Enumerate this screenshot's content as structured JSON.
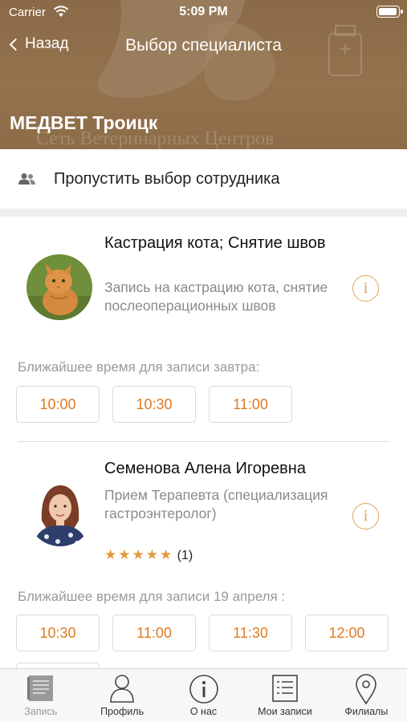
{
  "status_bar": {
    "carrier": "Carrier",
    "time": "5:09 PM"
  },
  "nav": {
    "back_label": "Назад",
    "title": "Выбор специалиста"
  },
  "header": {
    "clinic_name": "МЕДВЕТ Троицк",
    "background_text": "Сеть Ветеринарных Центров"
  },
  "skip": {
    "label": "Пропустить выбор сотрудника",
    "icon": "people-icon"
  },
  "specialists": [
    {
      "name": "Кастрация кота; Снятие швов",
      "description": "Запись на кастрацию кота, снятие послеоперационных швов",
      "nearest_label": "Ближайшее время для записи завтра:",
      "slots": [
        "10:00",
        "10:30",
        "11:00"
      ]
    },
    {
      "name": "Семенова Алена Игоревна",
      "description": "Прием Терапевта (специализация гастроэнтеролог)",
      "rating_stars": "★★★★★",
      "rating_count": "(1)",
      "nearest_label": "Ближайшее время для записи 19 апреля :",
      "slots": [
        "10:30",
        "11:00",
        "11:30",
        "12:00"
      ]
    }
  ],
  "tabs": [
    {
      "label": "Запись",
      "icon": "book-icon",
      "active": true
    },
    {
      "label": "Профиль",
      "icon": "person-icon",
      "active": false
    },
    {
      "label": "О нас",
      "icon": "info-icon",
      "active": false
    },
    {
      "label": "Мои записи",
      "icon": "list-icon",
      "active": false
    },
    {
      "label": "Филиалы",
      "icon": "map-pin-icon",
      "active": false
    }
  ],
  "colors": {
    "accent": "#e07a1f",
    "header_brown": "#8d6c48",
    "star": "#e39a3b"
  }
}
